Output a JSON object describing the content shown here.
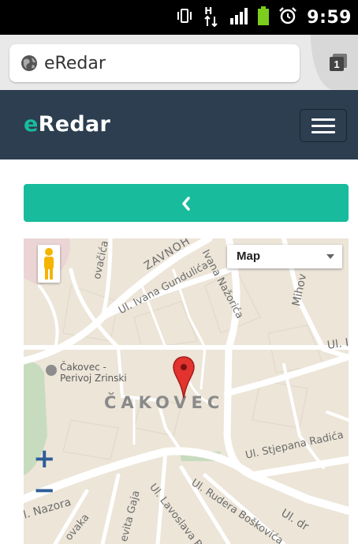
{
  "status_bar": {
    "time": "9:59",
    "signal_badge": "H",
    "icons": [
      "vibrate-icon",
      "data-arrows-icon",
      "signal-bars-icon",
      "battery-icon",
      "alarm-icon"
    ]
  },
  "browser": {
    "url": "eRedar",
    "tab_count": "1"
  },
  "navbar": {
    "brand_accent": "e",
    "brand_rest": "Redar",
    "background": "#2c3e50",
    "accent_color": "#18bc9c"
  },
  "back_button": {
    "label": "‹",
    "color": "#18bc9c"
  },
  "map": {
    "type_selector": "Map",
    "zoom_in": "+",
    "zoom_out": "−",
    "poi": {
      "line1": "Čakovec -",
      "line2": "Perivoj Zrinski"
    },
    "city": "ČAKOVEC",
    "labels": {
      "zavnoh": "ZAVNOH",
      "ovacica": "ovačića",
      "ivana_nazorica": "Ivana Nažorića",
      "ivana_gundulica": "Ul. Ivana Gundulića",
      "mihov": "Mihov",
      "ul_right": "Ul. I",
      "stjepana_radica": "Ul. Stjepana Radića",
      "nazora": "Ul. Nazora",
      "vaka": "ovaka",
      "gaja": "evita Gaja",
      "lavoslava": "Ul. Lavoslava Ru",
      "rudera": "Ul. Rudera Boškovića",
      "ul_dr": "Ul. dr"
    }
  }
}
